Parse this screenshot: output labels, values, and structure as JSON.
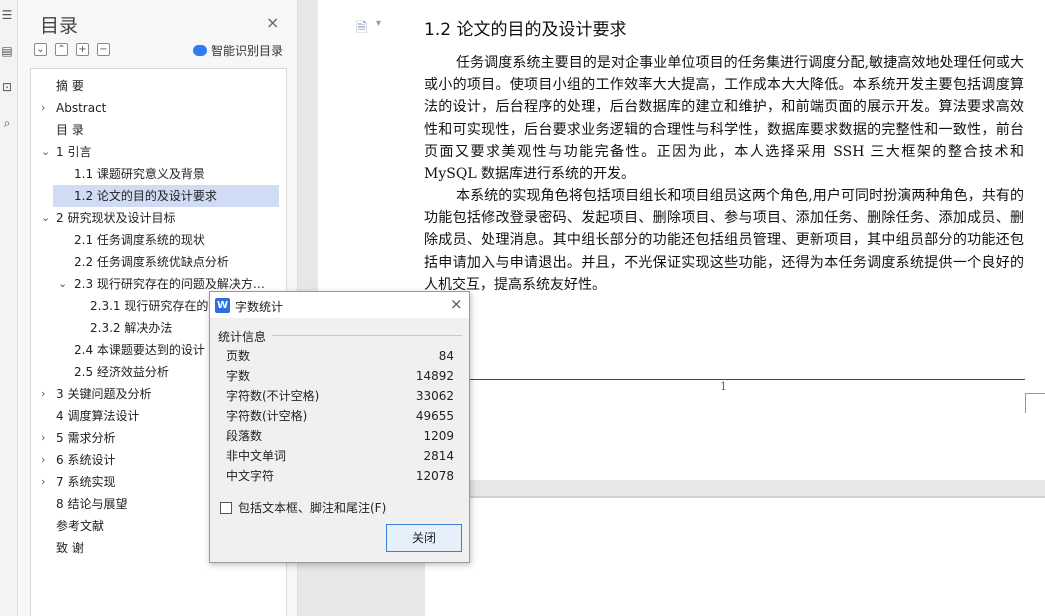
{
  "panel": {
    "title": "目录",
    "close": "×",
    "tools": [
      "⌄",
      "⌃",
      "+",
      "−"
    ],
    "smart_label": "智能识别目录",
    "items": [
      {
        "label": "摘  要",
        "arrow": "",
        "level": 0
      },
      {
        "label": "Abstract",
        "arrow": "›",
        "level": 0
      },
      {
        "label": "目  录",
        "arrow": "",
        "level": 0
      },
      {
        "label": "1  引言",
        "arrow": "⌄",
        "level": 0
      },
      {
        "label": "1.1  课题研究意义及背景",
        "arrow": "",
        "level": 1
      },
      {
        "label": "1.2  论文的目的及设计要求",
        "arrow": "",
        "level": 1,
        "selected": true
      },
      {
        "label": "2  研究现状及设计目标",
        "arrow": "⌄",
        "level": 0
      },
      {
        "label": "2.1  任务调度系统的现状",
        "arrow": "",
        "level": 1
      },
      {
        "label": "2.2  任务调度系统优缺点分析",
        "arrow": "",
        "level": 1
      },
      {
        "label": "2.3 现行研究存在的问题及解决方…",
        "arrow": "⌄",
        "level": 1
      },
      {
        "label": "2.3.1  现行研究存在的",
        "arrow": "",
        "level": 2
      },
      {
        "label": "2.3.2  解决办法",
        "arrow": "",
        "level": 2
      },
      {
        "label": "2.4  本课题要达到的设计",
        "arrow": "",
        "level": 1
      },
      {
        "label": "2.5  经济效益分析",
        "arrow": "",
        "level": 1
      },
      {
        "label": "3  关键问题及分析",
        "arrow": "›",
        "level": 0
      },
      {
        "label": "4  调度算法设计",
        "arrow": "",
        "level": 0
      },
      {
        "label": "5  需求分析",
        "arrow": "›",
        "level": 0
      },
      {
        "label": "6  系统设计",
        "arrow": "›",
        "level": 0
      },
      {
        "label": "7  系统实现",
        "arrow": "›",
        "level": 0
      },
      {
        "label": "8  结论与展望",
        "arrow": "",
        "level": 0
      },
      {
        "label": "参考文献",
        "arrow": "",
        "level": 0
      },
      {
        "label": "致  谢",
        "arrow": "",
        "level": 0
      }
    ]
  },
  "document": {
    "heading": "1.2   论文的目的及设计要求",
    "para1": "任务调度系统主要目的是对企事业单位项目的任务集进行调度分配,敏捷高效地处理任何或大或小的项目。使项目小组的工作效率大大提高，工作成本大大降低。本系统开发主要包括调度算法的设计，后台程序的处理，后台数据库的建立和维护，和前端页面的展示开发。算法要求高效性和可实现性，后台要求业务逻辑的合理性与科学性，数据库要求数据的完整性和一致性，前台页面又要求美观性与功能完备性。正因为此，本人选择采用 SSH 三大框架的整合技术和 MySQL 数据库进行系统的开发。",
    "para2": "本系统的实现角色将包括项目组长和项目组员这两个角色,用户可同时扮演两种角色，共有的功能包括修改登录密码、发起项目、删除项目、参与项目、添加任务、删除任务、添加成员、删除成员、处理消息。其中组长部分的功能还包括组员管理、更新项目，其中组员部分的功能还包括申请加入与申请退出。并且，不光保证实现这些功能，还得为本任务调度系统提供一个良好的人机交互，提高系统友好性。",
    "page_number": "1"
  },
  "dialog": {
    "logo": "W",
    "title": "字数统计",
    "close": "×",
    "group": "统计信息",
    "stats": [
      {
        "label": "页数",
        "value": "84"
      },
      {
        "label": "字数",
        "value": "14892"
      },
      {
        "label": "字符数(不计空格)",
        "value": "33062"
      },
      {
        "label": "字符数(计空格)",
        "value": "49655"
      },
      {
        "label": "段落数",
        "value": "1209"
      },
      {
        "label": "非中文单词",
        "value": "2814"
      },
      {
        "label": "中文字符",
        "value": "12078"
      }
    ],
    "checkbox_label": "包括文本框、脚注和尾注(F)",
    "close_button": "关闭"
  }
}
